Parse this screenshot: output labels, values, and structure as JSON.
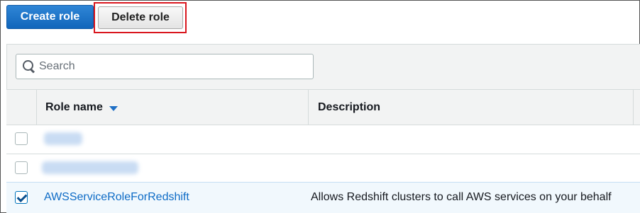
{
  "toolbar": {
    "create_label": "Create role",
    "delete_label": "Delete role"
  },
  "search": {
    "placeholder": "Search",
    "value": ""
  },
  "table": {
    "columns": [
      "Role name",
      "Description"
    ],
    "sort_column": "Role name",
    "sort_direction": "descending",
    "rows": [
      {
        "checked": false,
        "role_name": "",
        "description": "",
        "redacted": true
      },
      {
        "checked": false,
        "role_name": "",
        "description": "",
        "redacted": true
      },
      {
        "checked": true,
        "role_name": "AWSServiceRoleForRedshift",
        "description": "Allows Redshift clusters to call AWS services on your behalf",
        "redacted": false
      }
    ]
  },
  "colors": {
    "primary_button": "#1166bb",
    "highlight_box": "#d9161e",
    "link": "#0d6bc6",
    "selected_row": "#f1f8fd"
  },
  "icons": [
    "search-icon",
    "sort-desc-icon",
    "checkbox-icon"
  ]
}
